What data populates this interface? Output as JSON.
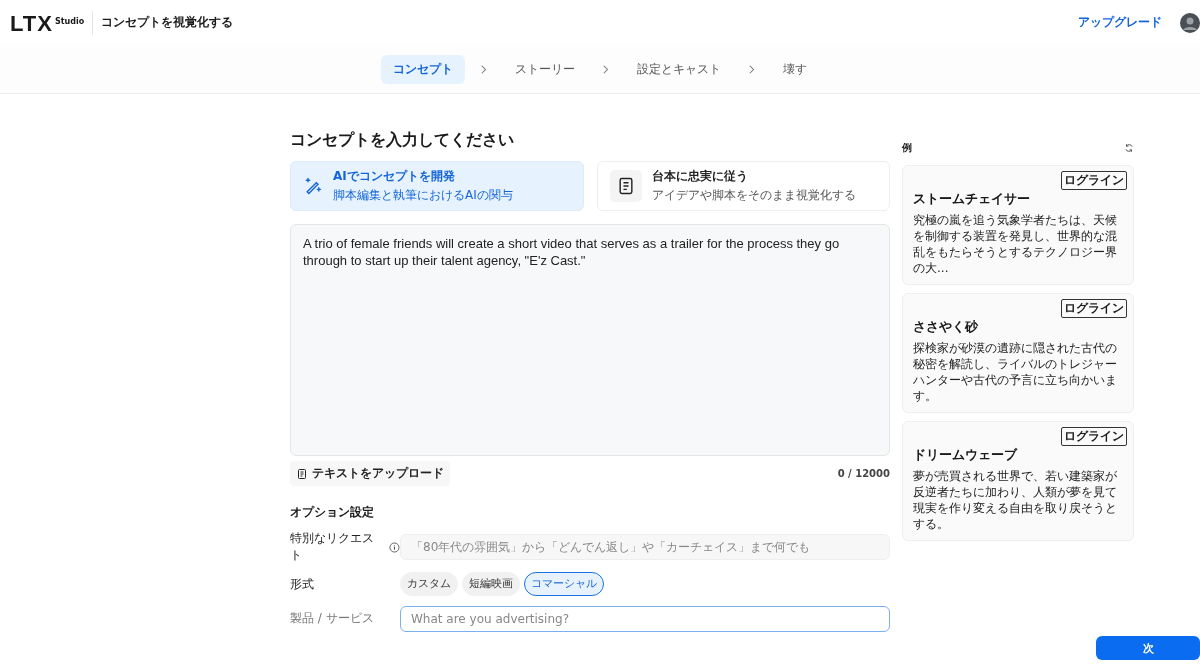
{
  "header": {
    "logo": "LTX",
    "logo_sub": "Studio",
    "title": "コンセプトを視覚化する",
    "upgrade": "アップグレード"
  },
  "steps": [
    {
      "label": "コンセプト",
      "selected": true
    },
    {
      "label": "ストーリー",
      "selected": false
    },
    {
      "label": "設定とキャスト",
      "selected": false
    },
    {
      "label": "壊す",
      "selected": false
    }
  ],
  "heading": "コンセプトを入力してください",
  "modes": [
    {
      "kind": "ai",
      "title": "AIでコンセプトを開発",
      "subtitle": "脚本編集と執筆におけるAIの関与",
      "selected": true
    },
    {
      "kind": "script",
      "title": "台本に忠実に従う",
      "subtitle": "アイデアや脚本をそのまま視覚化する",
      "selected": false
    }
  ],
  "concept": {
    "value": "A trio of female friends will create a short video that serves as a trailer for the process they go through to start up their talent agency, \"E'z Cast.\"",
    "counter": "0 / 12000"
  },
  "upload": "テキストをアップロード",
  "options": {
    "heading": "オプション設定",
    "request_label": "特別なリクエスト",
    "request_placeholder": "「80年代の雰囲気」から「どんでん返し」や「カーチェイス」まで何でも",
    "format_label": "形式",
    "formats": [
      {
        "label": "カスタム",
        "selected": false
      },
      {
        "label": "短編映画",
        "selected": false
      },
      {
        "label": "コマーシャル",
        "selected": true
      }
    ],
    "product_label": "製品 / サービス",
    "product_placeholder": "What are you advertising?"
  },
  "examples": {
    "title": "例",
    "items": [
      {
        "tag": "ログライン",
        "title": "ストームチェイサー",
        "text": "究極の嵐を追う気象学者たちは、天候を制御する装置を発見し、世界的な混乱をもたらそうとするテクノロジー界の大..."
      },
      {
        "tag": "ログライン",
        "title": "ささやく砂",
        "text": "探検家が砂漠の遺跡に隠された古代の秘密を解読し、ライバルのトレジャーハンターや古代の予言に立ち向かいます。"
      },
      {
        "tag": "ログライン",
        "title": "ドリームウェーブ",
        "text": "夢が売買される世界で、若い建築家が反逆者たちに加わり、人類が夢を見て現実を作り変える自由を取り戻そうとする。"
      }
    ]
  },
  "next": "次"
}
